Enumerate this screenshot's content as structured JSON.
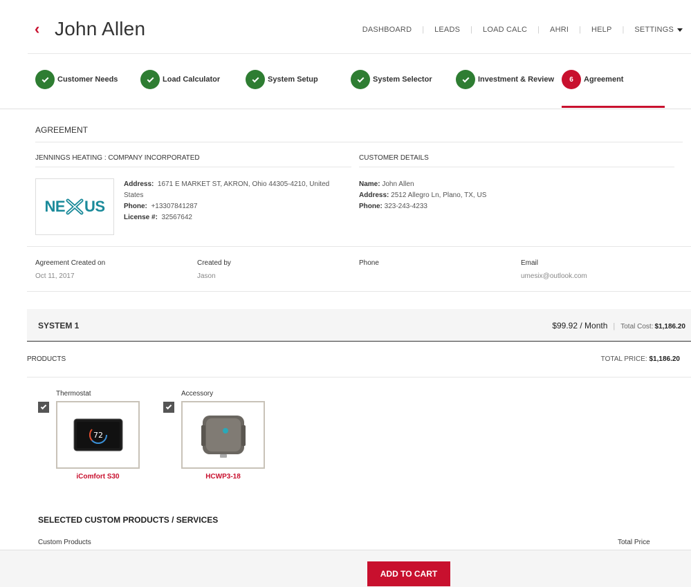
{
  "header": {
    "title": "John Allen",
    "back_glyph": "‹",
    "nav": [
      "DASHBOARD",
      "LEADS",
      "LOAD CALC",
      "AHRI",
      "HELP",
      "SETTINGS"
    ]
  },
  "steps": [
    {
      "label": "Customer Needs",
      "state": "done"
    },
    {
      "label": "Load Calculator",
      "state": "done"
    },
    {
      "label": "System Setup",
      "state": "done"
    },
    {
      "label": "System Selector",
      "state": "done"
    },
    {
      "label": "Investment & Review",
      "state": "done"
    },
    {
      "label": "Agreement",
      "state": "active",
      "number": "6"
    }
  ],
  "agreement": {
    "heading": "AGREEMENT",
    "company": {
      "heading": "JENNINGS HEATING : COMPANY INCORPORATED",
      "logo_text_left": "NE",
      "logo_text_right": "US",
      "address_label": "Address:",
      "address": "1671 E MARKET ST, AKRON, Ohio 44305-4210, United States",
      "phone_label": "Phone:",
      "phone": "+13307841287",
      "license_label": "License #:",
      "license": "32567642"
    },
    "customer": {
      "heading": "CUSTOMER DETAILS",
      "name_label": "Name:",
      "name": "John Allen",
      "address_label": "Address:",
      "address": "2512 Allegro Ln, Plano, TX, US",
      "phone_label": "Phone:",
      "phone": "323-243-4233"
    },
    "meta": {
      "created_on_label": "Agreement Created on",
      "created_on": "Oct 11, 2017",
      "created_by_label": "Created by",
      "created_by": "Jason",
      "phone_label": "Phone",
      "phone": "",
      "email_label": "Email",
      "email": "umesix@outlook.com"
    }
  },
  "system": {
    "title": "SYSTEM 1",
    "monthly": "$99.92 / Month",
    "total_cost_label": "Total Cost:",
    "total_cost": "$1,186.20"
  },
  "products": {
    "label": "PRODUCTS",
    "total_price_label": "TOTAL PRICE:",
    "total_price": "$1,186.20",
    "items": [
      {
        "category": "Thermostat",
        "name": "iComfort S30",
        "checked": true,
        "display_temp": "72"
      },
      {
        "category": "Accessory",
        "name": "HCWP3-18",
        "checked": true
      }
    ]
  },
  "custom": {
    "title": "SELECTED CUSTOM PRODUCTS / SERVICES",
    "col_products": "Custom Products",
    "col_total": "Total Price"
  },
  "footer": {
    "cart_label": "ADD TO CART"
  },
  "colors": {
    "accent": "#c8102e",
    "done": "#2e7d32",
    "logo": "#1a8a9a"
  }
}
